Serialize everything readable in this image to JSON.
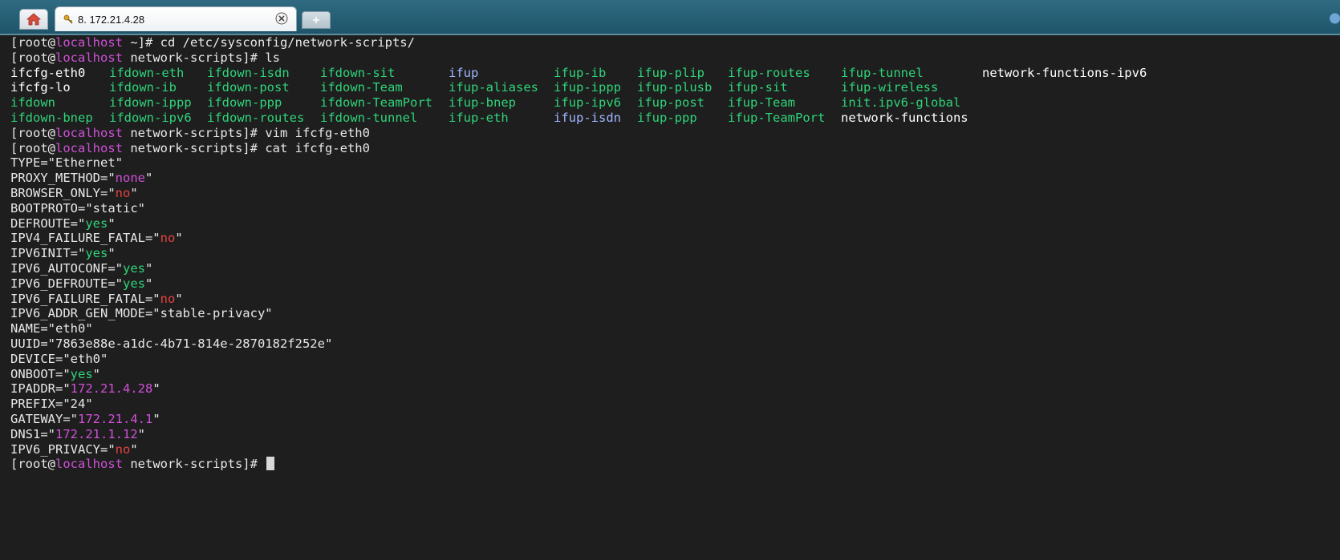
{
  "tabs": {
    "home_icon": "home-icon",
    "active_title": "8. 172.21.4.28",
    "active_icon": "key-icon",
    "close_icon": "close-icon",
    "new_tab_icon": "plus-icon"
  },
  "prompt": {
    "open": "[root@",
    "host": "localhost",
    "dir_home": " ~]# ",
    "dir_ns": " network-scripts]# "
  },
  "commands": {
    "cd": "cd /etc/sysconfig/network-scripts/",
    "ls": "ls",
    "vim": "vim ifcfg-eth0",
    "cat": "cat ifcfg-eth0"
  },
  "ls_rows": [
    [
      "ifcfg-eth0",
      "ifdown-eth",
      "ifdown-isdn",
      "ifdown-sit",
      "ifup",
      "ifup-ib",
      "ifup-plip",
      "ifup-routes",
      "ifup-tunnel",
      "network-functions-ipv6"
    ],
    [
      "ifcfg-lo",
      "ifdown-ib",
      "ifdown-post",
      "ifdown-Team",
      "ifup-aliases",
      "ifup-ippp",
      "ifup-plusb",
      "ifup-sit",
      "ifup-wireless",
      ""
    ],
    [
      "ifdown",
      "ifdown-ippp",
      "ifdown-ppp",
      "ifdown-TeamPort",
      "ifup-bnep",
      "ifup-ipv6",
      "ifup-post",
      "ifup-Team",
      "init.ipv6-global",
      ""
    ],
    [
      "ifdown-bnep",
      "ifdown-ipv6",
      "ifdown-routes",
      "ifdown-tunnel",
      "ifup-eth",
      "ifup-isdn",
      "ifup-ppp",
      "ifup-TeamPort",
      "network-functions",
      ""
    ]
  ],
  "config": [
    {
      "key": "TYPE=\"",
      "val": "Ethernet",
      "end": "\""
    },
    {
      "key": "PROXY_METHOD=\"",
      "val": "none",
      "end": "\""
    },
    {
      "key": "BROWSER_ONLY=\"",
      "val": "no",
      "end": "\""
    },
    {
      "key": "BOOTPROTO=\"",
      "val": "static",
      "end": "\""
    },
    {
      "key": "DEFROUTE=\"",
      "val": "yes",
      "end": "\""
    },
    {
      "key": "IPV4_FAILURE_FATAL=\"",
      "val": "no",
      "end": "\""
    },
    {
      "key": "IPV6INIT=\"",
      "val": "yes",
      "end": "\""
    },
    {
      "key": "IPV6_AUTOCONF=\"",
      "val": "yes",
      "end": "\""
    },
    {
      "key": "IPV6_DEFROUTE=\"",
      "val": "yes",
      "end": "\""
    },
    {
      "key": "IPV6_FAILURE_FATAL=\"",
      "val": "no",
      "end": "\""
    },
    {
      "key": "IPV6_ADDR_GEN_MODE=\"",
      "val": "stable-privacy",
      "end": "\""
    },
    {
      "key": "NAME=\"",
      "val": "eth0",
      "end": "\""
    },
    {
      "key": "UUID=\"",
      "val": "7863e88e-a1dc-4b71-814e-2870182f252e",
      "end": "\""
    },
    {
      "key": "DEVICE=\"",
      "val": "eth0",
      "end": "\""
    },
    {
      "key": "ONBOOT=\"",
      "val": "yes",
      "end": "\""
    },
    {
      "key": "IPADDR=\"",
      "val": "172.21.4.28",
      "end": "\""
    },
    {
      "key": "PREFIX=\"",
      "val": "24",
      "end": "\""
    },
    {
      "key": "GATEWAY=\"",
      "val": "172.21.4.1",
      "end": "\""
    },
    {
      "key": "DNS1=\"",
      "val": "172.21.1.12",
      "end": "\""
    },
    {
      "key": "IPV6_PRIVACY=\"",
      "val": "no",
      "end": "\""
    }
  ],
  "colors": {
    "green": "#2fd47a",
    "magenta": "#d050d8",
    "red": "#e5433f",
    "blue": "#9fb5ff",
    "white": "#ffffff",
    "tabbar": "#2f6b82"
  }
}
